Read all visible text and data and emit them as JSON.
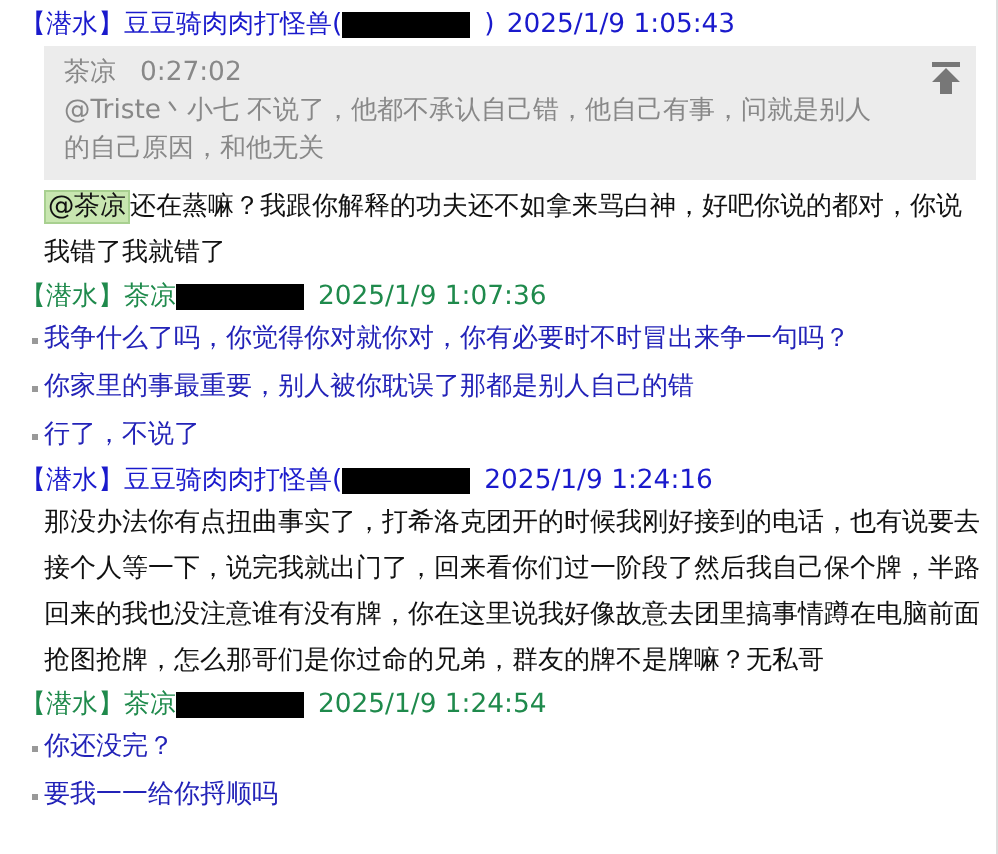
{
  "entries": [
    {
      "tag": "【潜水】",
      "author": "豆豆骑肉肉打怪兽(",
      "redacted": true,
      "close": ")",
      "time": "2025/1/9 1:05:43",
      "color": "#1a1acc",
      "quote": {
        "author": "茶凉",
        "time": "0:27:02",
        "text": "@Triste丶小七 不说了，他都不承认自己错，他自己有事，问就是别人的自己原因，和他无关"
      },
      "messages": [
        {
          "kind": "plain",
          "mention": "@茶凉",
          "text": "还在蒸嘛？我跟你解释的功夫还不如拿来骂白神，好吧你说的都对，你说我错了我就错了"
        }
      ]
    },
    {
      "tag": "【潜水】",
      "author": "茶凉",
      "redacted": true,
      "time": "2025/1/9 1:07:36",
      "color": "#1f8a4c",
      "messages": [
        {
          "kind": "bullet",
          "text": "我争什么了吗，你觉得你对就你对，你有必要时不时冒出来争一句吗？"
        },
        {
          "kind": "bullet",
          "text": "你家里的事最重要，别人被你耽误了那都是别人自己的错"
        },
        {
          "kind": "bullet",
          "text": "行了，不说了"
        }
      ]
    },
    {
      "tag": "【潜水】",
      "author": "豆豆骑肉肉打怪兽(",
      "redacted": true,
      "time": "2025/1/9 1:24:16",
      "color": "#1a1acc",
      "messages": [
        {
          "kind": "plain",
          "text": "那没办法你有点扭曲事实了，打希洛克团开的时候我刚好接到的电话，也有说要去接个人等一下，说完我就出门了，回来看你们过一阶段了然后我自己保个牌，半路回来的我也没注意谁有没有牌，你在这里说我好像故意去团里搞事情蹲在电脑前面抢图抢牌，怎么那哥们是你过命的兄弟，群友的牌不是牌嘛？无私哥"
        }
      ]
    },
    {
      "tag": "【潜水】",
      "author": "茶凉",
      "redacted": true,
      "time": "2025/1/9 1:24:54",
      "color": "#1f8a4c",
      "messages": [
        {
          "kind": "bullet",
          "text": "你还没完？"
        },
        {
          "kind": "bullet",
          "text": "要我一一给你捋顺吗"
        }
      ]
    }
  ]
}
